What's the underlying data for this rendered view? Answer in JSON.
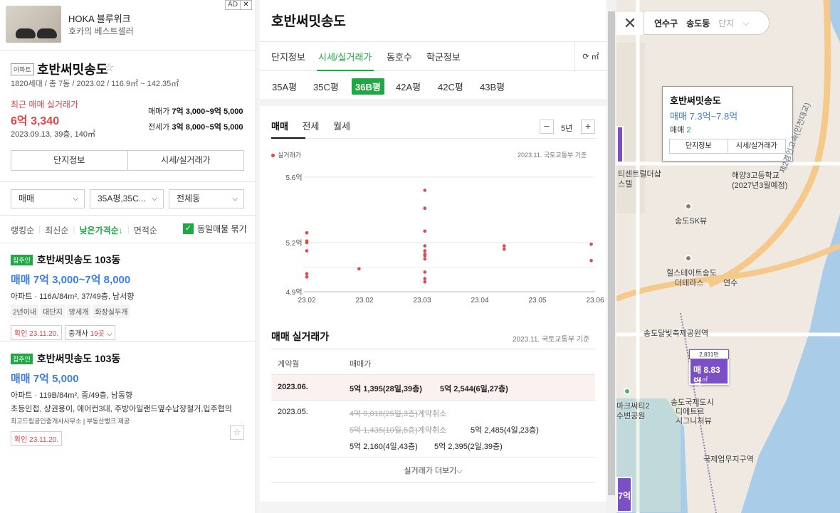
{
  "ad": {
    "title": "HOKA 블루위크",
    "subtitle": "호카의 베스트셀러",
    "badge": "AD",
    "close": "✕"
  },
  "complex": {
    "type": "아파트",
    "name": "호반써밋송도",
    "star": "☆",
    "info": "1820세대 / 총 7동 / 2023.02 / 116.9㎡ ~ 142.35㎡",
    "recent_label": "최근 매매 실거래가",
    "recent_price": "6억 3,340",
    "recent_date": "2023.09.13, 39층, 140㎡",
    "sale_range_label": "매매가",
    "sale_range": "7억 3,000~9억 5,000",
    "jeonse_range_label": "전세가",
    "jeonse_range": "3억 8,000~5억 5,000",
    "buttons": [
      "단지정보",
      "시세/실거래가"
    ]
  },
  "filters": {
    "deal": "매매",
    "size": "35A평,35C...",
    "dong": "전체동"
  },
  "sorts": {
    "items": [
      "랭킹순",
      "최신순",
      "낮은가격순↓",
      "면적순"
    ],
    "active": 2,
    "group_label": "동일매물 묶기",
    "check": "✓"
  },
  "listings": [
    {
      "tag": "집주인",
      "title": "호반써밋송도 103동",
      "price": "매매 7억 3,000~7억 8,000",
      "desc": "아파트 · 116A/84m², 37/49층, 남서향",
      "chips": [
        "2년이내",
        "대단지",
        "방세개",
        "화장실두개"
      ],
      "confirm": "확인 23.11.20.",
      "agent": "중개사",
      "agent_count": "19곳",
      "agent_chev": "⌵"
    },
    {
      "tag": "집주인",
      "title": "호반써밋송도 103동",
      "price": "매매 7억 5,000",
      "desc": "아파트 · 119B/84m², 중/49층, 남동향",
      "desc2": "초등인접, 상권용이, 에어컨3대, 주방아일랜드옆수납장철거,입주협의",
      "agency": "최고드림공인중개사사무소 | 부동산뱅크 제공",
      "confirm": "확인 23.11.20.",
      "star": "☆"
    }
  ],
  "detail": {
    "title": "호반써밋송도",
    "tabs": [
      "단지정보",
      "시세/실거래가",
      "동호수",
      "학군정보"
    ],
    "active_tab": 1,
    "refresh": "⟳ ㎡",
    "sizes": [
      "35A평",
      "35C평",
      "36B평",
      "42A평",
      "42C평",
      "43B평"
    ],
    "active_size": 2,
    "deal_tabs": [
      "매매",
      "전세",
      "월세"
    ],
    "period": "5년",
    "minus": "−",
    "plus": "+",
    "legend": "실거래가",
    "source": "2023.11. 국토교통부 기준",
    "trade_title": "매매 실거래가",
    "table_head": [
      "계약월",
      "매매가"
    ],
    "rows": [
      {
        "month": "2023.06.",
        "deals": [
          "5억 1,395(28일,39층)",
          "5억 2,544(6일,27층)"
        ]
      },
      {
        "month": "2023.05.",
        "cancelled": [
          "4억 9,018(25일,3층)",
          "5억 1,435(10일,5층)"
        ],
        "cancel_label": "계약취소",
        "deals": [
          "5억 2,485(4일,23층)",
          "5억 2,160(4일,43층)",
          "5억 2,395(2일,39층)"
        ]
      }
    ],
    "more": "실거래가 더보기⌵"
  },
  "chart_data": {
    "type": "scatter",
    "title": "",
    "xlabel": "",
    "ylabel": "",
    "x_ticks": [
      "23.02",
      "23.02",
      "23.03",
      "23.04",
      "23.05",
      "23.06"
    ],
    "y_ticks": [
      "5.6억",
      "5.2억",
      "4.9억"
    ],
    "ylim": [
      4.9,
      5.6
    ],
    "xlim": [
      "2023-02-01",
      "2023-06-30"
    ],
    "grid": true,
    "series": [
      {
        "name": "실거래가",
        "color": "#e0464a",
        "points": [
          [
            "2023-02-01",
            5.26
          ],
          [
            "2023-02-01",
            5.21
          ],
          [
            "2023-02-01",
            5.2
          ],
          [
            "2023-02-01",
            5.15
          ],
          [
            "2023-02-01",
            5.01
          ],
          [
            "2023-02-01",
            4.99
          ],
          [
            "2023-02-28",
            5.04
          ],
          [
            "2023-04-03",
            5.52
          ],
          [
            "2023-04-03",
            5.41
          ],
          [
            "2023-04-03",
            5.27
          ],
          [
            "2023-04-03",
            5.18
          ],
          [
            "2023-04-03",
            5.15
          ],
          [
            "2023-04-03",
            5.13
          ],
          [
            "2023-04-03",
            5.12
          ],
          [
            "2023-04-03",
            5.1
          ],
          [
            "2023-04-03",
            5.02
          ],
          [
            "2023-04-03",
            4.98
          ],
          [
            "2023-04-03",
            4.96
          ],
          [
            "2023-05-14",
            5.18
          ],
          [
            "2023-05-14",
            5.16
          ],
          [
            "2023-06-28",
            5.19
          ],
          [
            "2023-06-28",
            5.09
          ]
        ]
      }
    ]
  },
  "map": {
    "close": "✕",
    "crumbs": [
      "연수구",
      "송도동",
      "단지"
    ],
    "crumb_chev": "⌵",
    "popup": {
      "name": "호반써밋송도",
      "price": "매매 7.3억~7.8억",
      "sale_label": "매매",
      "sale_count": "2",
      "buttons": [
        "단지정보",
        "시세/실거래가"
      ]
    },
    "labels": [
      "티센트럴더샵",
      "스텔",
      "해양3고등학교",
      "(2027년3월예정)",
      "송도SK뷰",
      "힐스테이트송도",
      "더테라스",
      "연수",
      "송도달빛축제공원역",
      "송도국제도시",
      "디에트르",
      "시그니처뷰",
      "국제업무지구역",
      "마크써티2",
      "수변공원",
      "제2경인고속(인천대교)"
    ],
    "marker": {
      "top": "2,831만",
      "price": "매 8.83억",
      "area": "111㎡"
    },
    "edge_marker": "7억"
  },
  "colors": {
    "accent": "#1fa843",
    "price_red": "#e0464a",
    "price_blue": "#3d7fd9",
    "marker": "#7b4fc6"
  }
}
